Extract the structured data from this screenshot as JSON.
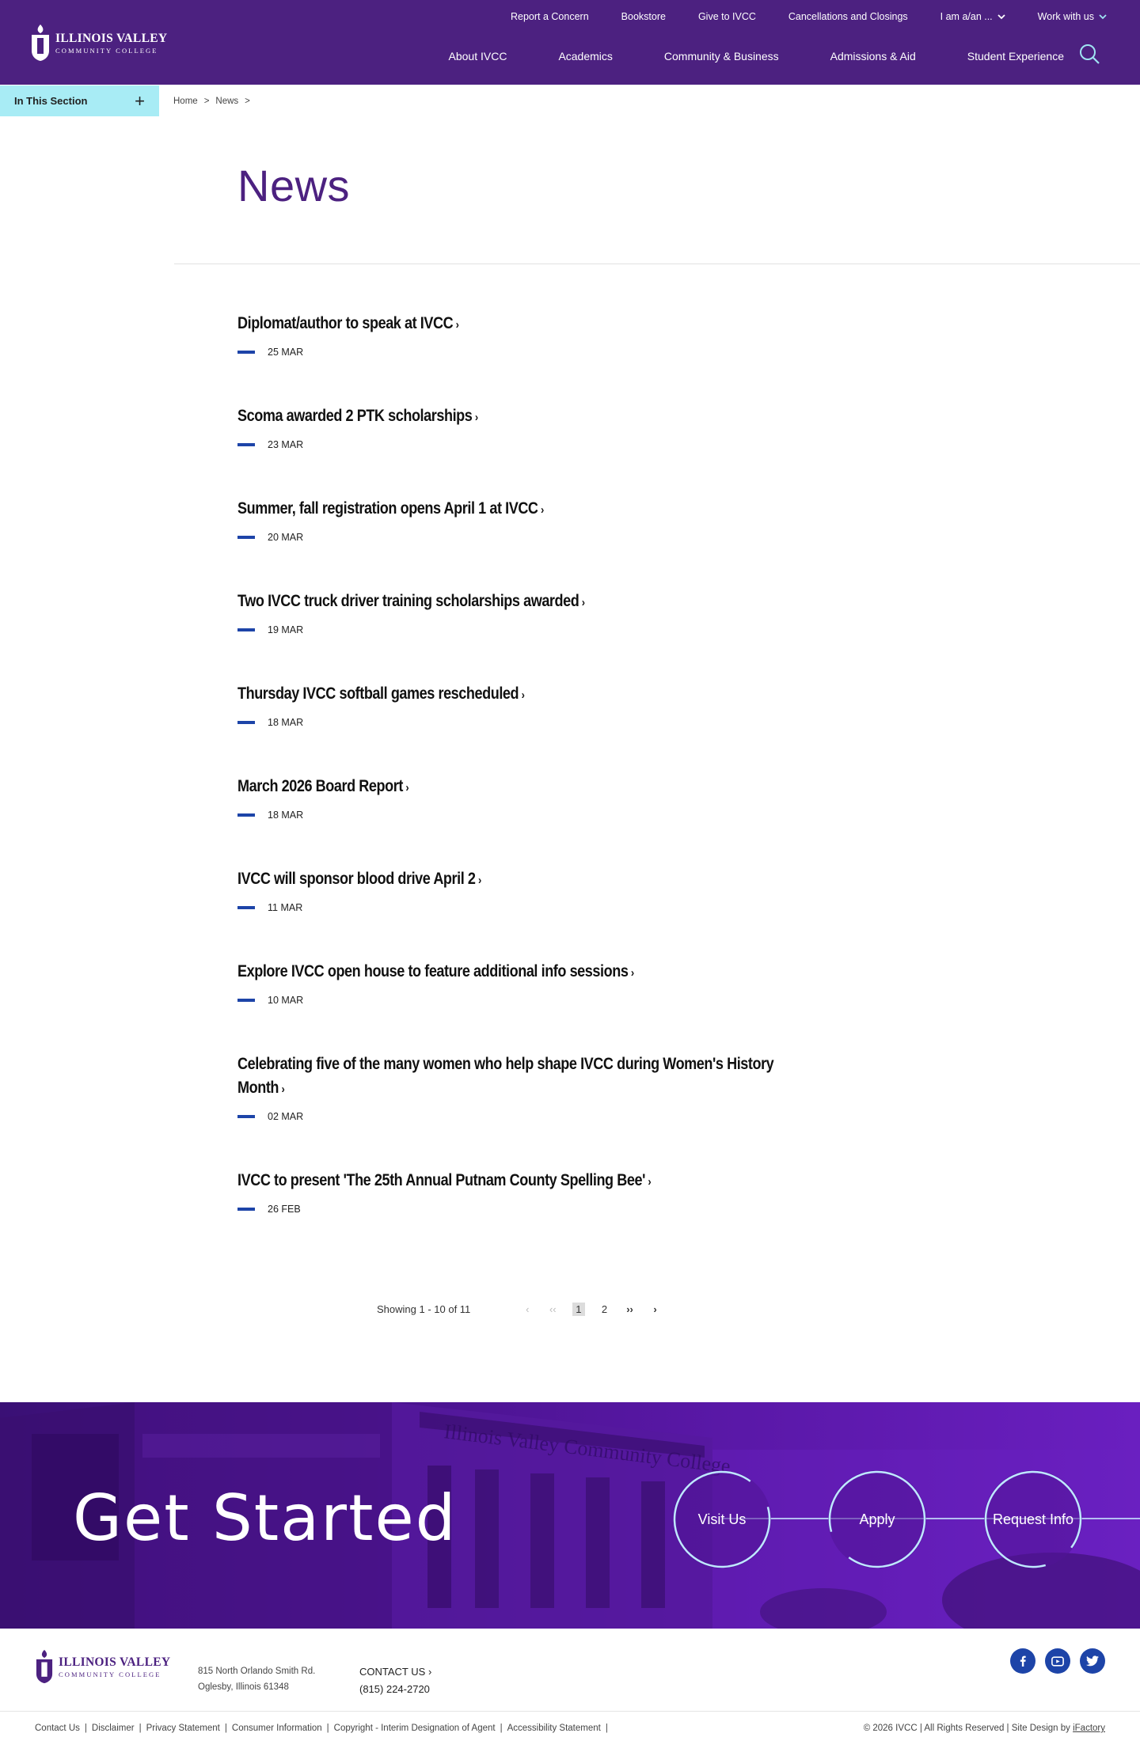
{
  "brand": {
    "logo_main": "ILLINOIS VALLEY",
    "logo_sub": "COMMUNITY COLLEGE",
    "primary_color": "#4c2180",
    "accent_color": "#1d44a8",
    "section_color": "#a8ecf5"
  },
  "utility_nav": [
    {
      "label": "Report a Concern"
    },
    {
      "label": "Bookstore"
    },
    {
      "label": "Give to IVCC"
    },
    {
      "label": "Cancellations and Closings"
    },
    {
      "label": "I am a/an ...",
      "icon": "chevron-down-icon"
    },
    {
      "label": "Work with us",
      "icon": "chevron-down-icon"
    }
  ],
  "main_nav": [
    {
      "label": "About IVCC"
    },
    {
      "label": "Academics"
    },
    {
      "label": "Community & Business"
    },
    {
      "label": "Admissions & Aid"
    },
    {
      "label": "Student Experience"
    }
  ],
  "section_bar": {
    "label": "In This Section",
    "icon": "plus-icon"
  },
  "breadcrumb": {
    "home": "Home",
    "sep": ">",
    "current": "News"
  },
  "page_title": "News",
  "news": [
    {
      "title": "Diplomat/author to speak at IVCC",
      "date": "25 MAR"
    },
    {
      "title": "Scoma awarded 2 PTK scholarships",
      "date": "23 MAR"
    },
    {
      "title": "Summer, fall registration opens April 1 at IVCC",
      "date": "20 MAR"
    },
    {
      "title": "Two IVCC truck driver training scholarships awarded",
      "date": "19 MAR"
    },
    {
      "title": "Thursday IVCC softball games rescheduled",
      "date": "18 MAR"
    },
    {
      "title": "March 2026 Board Report",
      "date": "18 MAR"
    },
    {
      "title": "IVCC will sponsor blood drive April 2",
      "date": "11 MAR"
    },
    {
      "title": "Explore IVCC open house to feature additional info sessions",
      "date": "10 MAR"
    },
    {
      "title": "Celebrating five of the many women who help shape IVCC during Women's History Month",
      "date": "02 MAR"
    },
    {
      "title": "IVCC to present 'The 25th Annual Putnam County Spelling Bee'",
      "date": "26 FEB"
    }
  ],
  "pagination": {
    "showing": "Showing 1 - 10 of 11",
    "prev": "‹",
    "first": "‹‹",
    "pages": [
      "1",
      "2"
    ],
    "current": "1",
    "last": "››",
    "next": "›"
  },
  "cta": {
    "title": "Get Started",
    "buttons": [
      {
        "label": "Visit Us"
      },
      {
        "label": "Apply"
      },
      {
        "label": "Request Info"
      }
    ],
    "building_text": "Illinois Valley Community College"
  },
  "footer": {
    "address_line1": "815 North Orlando Smith Rd.",
    "address_line2": "Oglesby, Illinois 61348",
    "contact_label": "CONTACT US",
    "phone": "(815) 224-2720",
    "social": [
      "facebook-icon",
      "youtube-icon",
      "twitter-icon"
    ],
    "links": [
      "Contact Us",
      "Disclaimer",
      "Privacy Statement",
      "Consumer Information",
      "Copyright - Interim Designation of Agent",
      "Accessibility Statement"
    ],
    "link_sep": "|",
    "copyright_prefix": "© 2026 IVCC | All Rights Reserved | Site Design by",
    "copyright_link": "iFactory"
  }
}
